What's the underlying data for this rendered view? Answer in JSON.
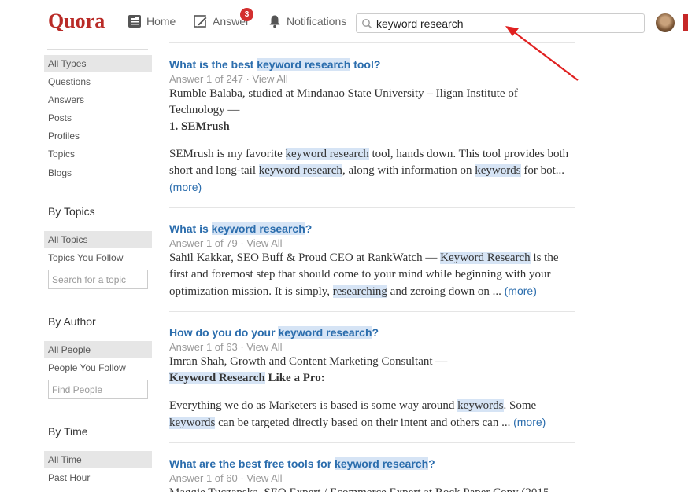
{
  "header": {
    "logo": "Quora",
    "nav": {
      "home": "Home",
      "answer": "Answer",
      "notifications": "Notifications"
    },
    "answer_badge": "3",
    "search_value": "keyword research"
  },
  "sidebar": {
    "types": [
      "All Types",
      "Questions",
      "Answers",
      "Posts",
      "Profiles",
      "Topics",
      "Blogs"
    ],
    "by_topics": {
      "heading": "By Topics",
      "items": [
        "All Topics",
        "Topics You Follow"
      ],
      "placeholder": "Search for a topic"
    },
    "by_author": {
      "heading": "By Author",
      "items": [
        "All People",
        "People You Follow"
      ],
      "placeholder": "Find People"
    },
    "by_time": {
      "heading": "By Time",
      "items": [
        "All Time",
        "Past Hour"
      ]
    }
  },
  "results": [
    {
      "title_pre": "What is the best ",
      "title_hl": "keyword research",
      "title_post": " tool?",
      "meta": "Answer 1 of 247 · View All",
      "author": "Rumble Balaba, studied at Mindanao State University – Iligan Institute of Technology —",
      "bold_line": "1. SEMrush",
      "snippet_a": "SEMrush is my favorite ",
      "snippet_hl1": "keyword research",
      "snippet_b": " tool, hands down. This tool provides both short and long-tail ",
      "snippet_hl2": "keyword research",
      "snippet_c": ", along with information on ",
      "snippet_hl3": "keywords",
      "snippet_d": " for bot... ",
      "more": "(more)"
    },
    {
      "title_pre": "What is ",
      "title_hl": "keyword research",
      "title_post": "?",
      "meta": "Answer 1 of 79 · View All",
      "snippet_a": "Sahil Kakkar, SEO Buff & Proud CEO at RankWatch — ",
      "snippet_hl1": "Keyword Research",
      "snippet_b": " is the first and foremost step that should come to your mind while beginning with your optimization mission. It is simply, ",
      "snippet_hl2": "researching",
      "snippet_c": " and zeroing down on ... ",
      "more": "(more)"
    },
    {
      "title_pre": "How do you do your ",
      "title_hl": "keyword research",
      "title_post": "?",
      "meta": "Answer 1 of 63 · View All",
      "author": "Imran Shah, Growth and Content Marketing Consultant —",
      "bold_hl": "Keyword Research",
      "bold_post": " Like a Pro:",
      "snippet_a": "Everything we do as Marketers is based is some way around ",
      "snippet_hl1": "keywords",
      "snippet_b": ". Some ",
      "snippet_hl2": "keywords",
      "snippet_c": " can be targeted directly based on their intent and others can ... ",
      "more": "(more)"
    },
    {
      "title_pre": "What are the best free tools for ",
      "title_hl": "keyword research",
      "title_post": "?",
      "meta": "Answer 1 of 60 · View All",
      "author": "Maggie Tuczapska, SEO Expert / Ecommerce Expert at Rock Paper Copy (2015"
    }
  ],
  "colors": {
    "brand": "#b92b27",
    "link": "#2b6dad",
    "highlight": "#d6e4f5",
    "badge": "#d32f2f",
    "arrow": "#e02020"
  },
  "icons": [
    "home-icon",
    "answer-pencil-icon",
    "bell-icon",
    "search-icon",
    "avatar"
  ]
}
